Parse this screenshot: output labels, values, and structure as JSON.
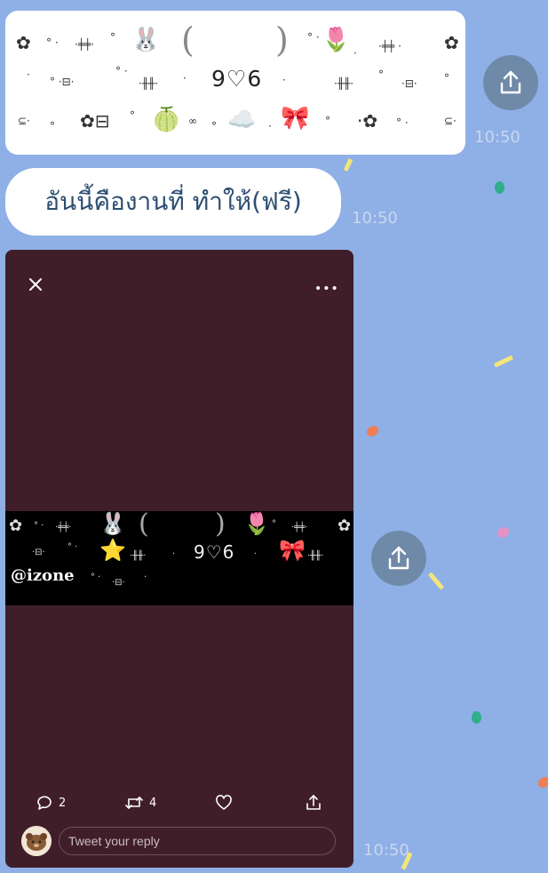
{
  "chat": {
    "messages": [
      {
        "type": "image",
        "time": "10:50",
        "image_text": "9♡6"
      },
      {
        "type": "text",
        "text": "อันนี้คืองานที่  ทำให้(ฟรี)",
        "time": "10:50"
      },
      {
        "type": "tweet_media",
        "time": "10:50",
        "banner_text": "9♡6",
        "handle": "@izone",
        "reply_count": "2",
        "retweet_count": "4",
        "reply_placeholder": "Tweet your reply"
      }
    ]
  },
  "icons": {
    "share": "share-icon",
    "close": "close-icon",
    "more": "more-icon",
    "reply": "comment-icon",
    "retweet": "retweet-icon",
    "like": "heart-icon",
    "tweet_share": "share-icon"
  },
  "colors": {
    "chat_background": "#8fb0e6",
    "bubble": "#ffffff",
    "bubble_text": "#2c4e72",
    "share_button": "#6f8aa8",
    "tweet_card": "#401e29",
    "timestamp": "#c9d6ee"
  }
}
